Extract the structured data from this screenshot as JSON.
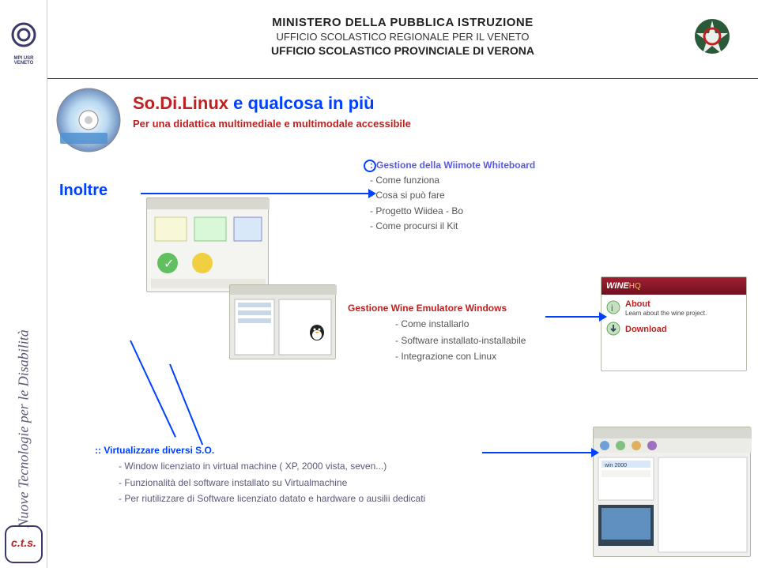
{
  "sidebar": {
    "top_logo_text": "MPI USR VENETO",
    "vertical_text": "Nuove Tecnologie per le Disabilità",
    "bottom_logo_text": "c.t.s."
  },
  "header": {
    "line1": "MINISTERO DELLA PUBBLICA ISTRUZIONE",
    "line2": "UFFICIO SCOLASTICO REGIONALE PER IL VENETO",
    "line3": "UFFICIO SCOLASTICO PROVINCIALE DI VERONA"
  },
  "title": {
    "sodi": "So.Di.Linux",
    "rest": " e qualcosa in più",
    "subtitle": "Per una didattica  multimediale e multimodale accessibile"
  },
  "inoltre": "Inoltre",
  "wii": {
    "heading": "::Gestione della Wiimote Whiteboard",
    "items": [
      "- Come funziona",
      "- Cosa si può fare",
      "- Progetto Wiidea - Bo",
      "- Come procursi il Kit"
    ]
  },
  "wine": {
    "heading": "Gestione Wine Emulatore Windows",
    "items": [
      "- Come installarlo",
      "- Software installato-installabile",
      "- Integrazione con Linux"
    ]
  },
  "wine_panel": {
    "about": "About",
    "about_sub": "Learn about the wine project.",
    "download": "Download"
  },
  "virt": {
    "heading": ":: Virtualizzare  diversi S.O.",
    "items": [
      "- Window licenziato in virtual machine ( XP,  2000 vista, seven...)",
      "- Funzionalità del software installato su Virtualmachine",
      "- Per riutilizzare di Software licenziato datato e hardware o ausilii dedicati"
    ]
  }
}
